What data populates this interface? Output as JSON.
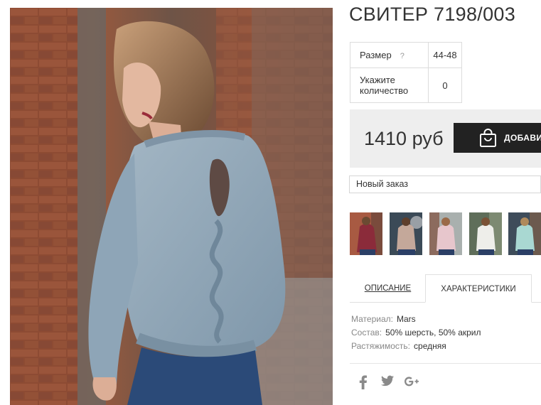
{
  "product": {
    "title": "СВИТЕР 7198/003",
    "photo_icon": "product-photo-woman-grey-sweater"
  },
  "options": {
    "size_label": "Размер",
    "size_help": "?",
    "size_value": "44-48",
    "quantity_label": "Укажите количество",
    "quantity_value": "0"
  },
  "price": {
    "text": "1410 руб",
    "add_button_label": "ДОБАВИТЬ",
    "cart_icon": "shopping-bag-icon"
  },
  "order_select": {
    "selected": "Новый заказ"
  },
  "thumbnails": [
    {
      "icon": "thumb-burgundy-sweater",
      "color": "#8b2b3a"
    },
    {
      "icon": "thumb-beige-sweater",
      "color": "#c4a89a"
    },
    {
      "icon": "thumb-pink-sweater",
      "color": "#e7c6cc"
    },
    {
      "icon": "thumb-white-sweater",
      "color": "#eeeeea"
    },
    {
      "icon": "thumb-mint-sweater",
      "color": "#a9d8d2"
    }
  ],
  "tabs": {
    "description": "ОПИСАНИЕ",
    "characteristics": "ХАРАКТЕРИСТИКИ",
    "active": "characteristics"
  },
  "specs": [
    {
      "key": "Материал:",
      "value": "Mars"
    },
    {
      "key": "Состав:",
      "value": "50% шерсть, 50% акрил"
    },
    {
      "key": "Растяжимость:",
      "value": "средняя"
    }
  ],
  "social": [
    {
      "icon": "facebook-icon",
      "glyph": "f"
    },
    {
      "icon": "twitter-icon",
      "glyph": ""
    },
    {
      "icon": "google-plus-icon",
      "glyph": "g+"
    }
  ],
  "colors": {
    "button_bg": "#222222",
    "price_bg": "#eeeeee",
    "sweater": "#8fa6b8"
  }
}
